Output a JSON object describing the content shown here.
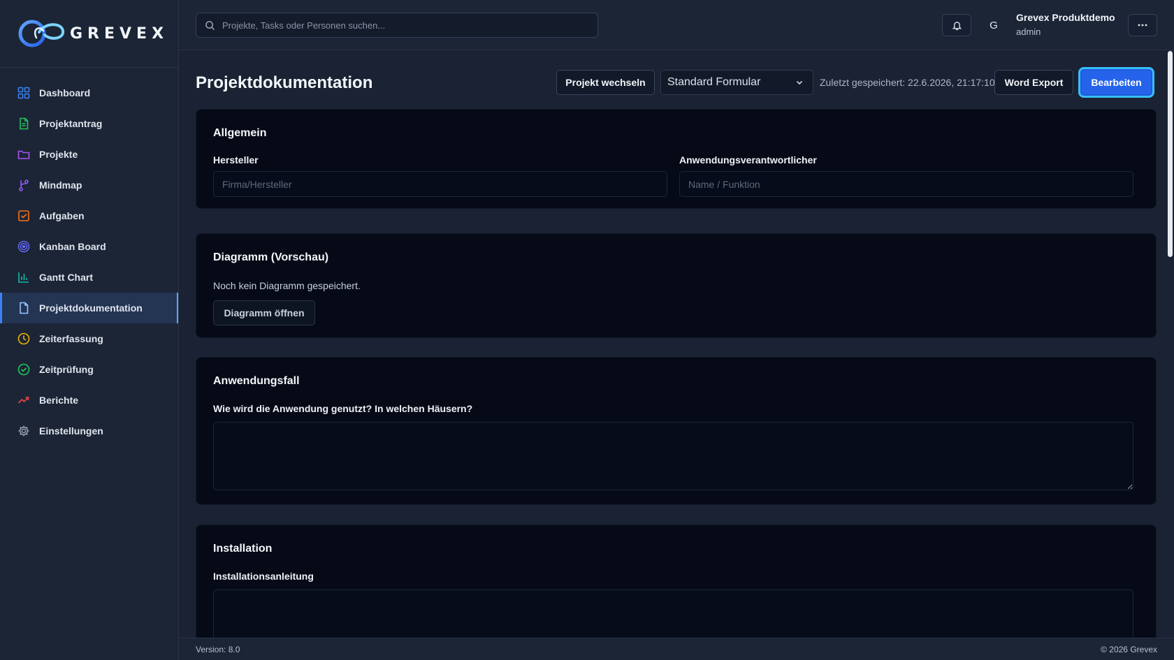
{
  "brand": {
    "name": "GREVEX",
    "accent": "#3b82f6"
  },
  "search": {
    "placeholder": "Projekte, Tasks oder Personen suchen..."
  },
  "user": {
    "avatar_initial": "G",
    "name": "Grevex Produktdemo",
    "role": "admin"
  },
  "sidebar": {
    "items": [
      {
        "label": "Dashboard",
        "icon": "dashboard-icon",
        "color": "#3b82f6",
        "active": false
      },
      {
        "label": "Projektantrag",
        "icon": "document-icon",
        "color": "#22c55e",
        "active": false
      },
      {
        "label": "Projekte",
        "icon": "folder-icon",
        "color": "#a855f7",
        "active": false
      },
      {
        "label": "Mindmap",
        "icon": "branch-icon",
        "color": "#8b5cf6",
        "active": false
      },
      {
        "label": "Aufgaben",
        "icon": "checkbox-icon",
        "color": "#f97316",
        "active": false
      },
      {
        "label": "Kanban Board",
        "icon": "target-icon",
        "color": "#6366f1",
        "active": false
      },
      {
        "label": "Gantt Chart",
        "icon": "bar-chart-icon",
        "color": "#14b8a6",
        "active": false
      },
      {
        "label": "Projektdokumentation",
        "icon": "file-icon",
        "color": "#93c5fd",
        "active": true
      },
      {
        "label": "Zeiterfassung",
        "icon": "clock-icon",
        "color": "#eab308",
        "active": false
      },
      {
        "label": "Zeitprüfung",
        "icon": "check-circle-icon",
        "color": "#22c55e",
        "active": false
      },
      {
        "label": "Berichte",
        "icon": "trending-icon",
        "color": "#ef4444",
        "active": false
      },
      {
        "label": "Einstellungen",
        "icon": "gear-icon",
        "color": "#9ca3af",
        "active": false
      }
    ]
  },
  "header": {
    "title": "Projektdokumentation",
    "switch_label": "Projekt wechseln",
    "template_value": "Standard Formular",
    "last_saved": "Zuletzt gespeichert: 22.6.2026, 21:17:10",
    "word_export_label": "Word Export",
    "edit_label": "Bearbeiten"
  },
  "sections": {
    "general": {
      "title": "Allgemein",
      "manufacturer_label": "Hersteller",
      "manufacturer_placeholder": "Firma/Hersteller",
      "responsible_label": "Anwendungsverantwortlicher",
      "responsible_placeholder": "Name / Funktion"
    },
    "diagram": {
      "title": "Diagramm (Vorschau)",
      "empty_text": "Noch kein Diagramm gespeichert.",
      "open_label": "Diagramm öffnen"
    },
    "use_case": {
      "title": "Anwendungsfall",
      "question_label": "Wie wird die Anwendung genutzt? In welchen Häusern?"
    },
    "installation": {
      "title": "Installation",
      "guide_label": "Installationsanleitung"
    }
  },
  "footer": {
    "version": "Version: 8.0",
    "copyright": "© 2026 Grevex"
  }
}
